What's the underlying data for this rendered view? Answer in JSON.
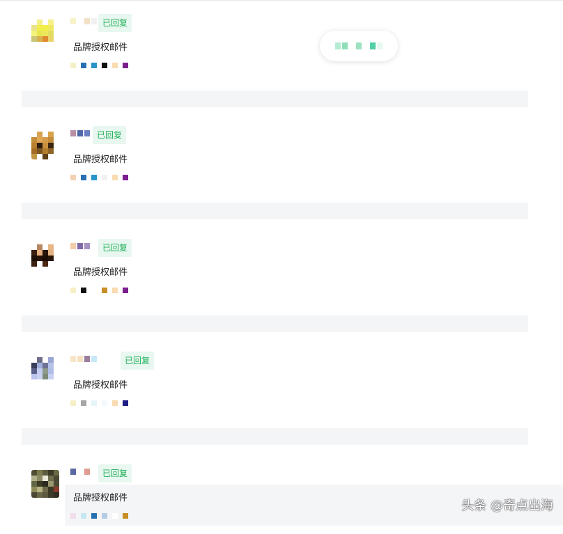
{
  "ui": {
    "replied_badge": "已回复",
    "subject": "品牌授权邮件",
    "watermark": "头条 @奇点出海",
    "colors": {
      "badge_bg": "#e8f7ef",
      "badge_text": "#20b15a",
      "separator": "#f4f5f7"
    }
  },
  "messages": [
    {
      "subject": "品牌授权邮件",
      "status": "已回复",
      "avatar_colors": [
        "#ffffff",
        "#f5ef8a",
        "#ffffff",
        "#f7f08a",
        "#ffffff",
        "#e9e38b",
        "#f2ef4b",
        "#f2ef4b",
        "#efe962",
        "#ffffff",
        "#f3f279",
        "#e8e650",
        "#ece65c",
        "#e3dc62",
        "#ffffff",
        "#c9c67a",
        "#d8b24e",
        "#e08a2e",
        "#e9d36b",
        "#ffffff",
        "#ffffff",
        "#ffffff",
        "#ffffff",
        "#ffffff",
        "#ffffff"
      ],
      "name_colors": [
        "#f7f3c8",
        "#ffffff",
        "#f2e1c5",
        "#f1f1f1"
      ],
      "detail_colors": [
        "#f6f0c7",
        "#2770b1",
        "#2995c9",
        "#111111",
        "#f8dbb0",
        "#7a1f8d"
      ]
    },
    {
      "subject": "品牌授权邮件",
      "status": "已回复",
      "avatar_colors": [
        "#ffffff",
        "#d9a354",
        "#ffffff",
        "#d7a24d",
        "#ffffff",
        "#c38d3b",
        "#e0a95a",
        "#d59b4b",
        "#c48b3a",
        "#ffffff",
        "#b77f2f",
        "#2c1d0f",
        "#c9913f",
        "#3a2612",
        "#ffffff",
        "#a36d23",
        "#7d5521",
        "#b27d2f",
        "#8f6527",
        "#ffffff",
        "#c29744",
        "#ffffff",
        "#5b4019",
        "#ffffff",
        "#ffffff"
      ],
      "name_colors": [
        "#b88fa9",
        "#5168a8",
        "#6b7fc3"
      ],
      "detail_colors": [
        "#f3d1b3",
        "#2770b1",
        "#2995c9",
        "#f1f1f1",
        "#f8dbb0",
        "#7a1f8d"
      ]
    },
    {
      "subject": "品牌授权邮件",
      "status": "已回复",
      "avatar_colors": [
        "#ffffff",
        "#b88760",
        "#ffffff",
        "#e8b684",
        "#ffffff",
        "#3a1e10",
        "#e5b07e",
        "#2a150a",
        "#e3b281",
        "#ffffff",
        "#1c0d05",
        "#281208",
        "#1a0b04",
        "#291409",
        "#ffffff",
        "#3c2011",
        "#ffffff",
        "#4a2814",
        "#ffffff",
        "#ffffff",
        "#ffffff",
        "#ffffff",
        "#ffffff",
        "#ffffff",
        "#ffffff"
      ],
      "name_colors": [
        "#f2cda9",
        "#7e6aa8",
        "#a591c2"
      ],
      "detail_colors": [
        "#f6f0c7",
        "#111111",
        "#ffffff",
        "#c88f25",
        "#f8dbb0",
        "#7a1f8d"
      ]
    },
    {
      "subject": "品牌授权邮件",
      "status": "已回复",
      "avatar_colors": [
        "#ffffff",
        "#6d6f88",
        "#ffffff",
        "#9aa7d4",
        "#ffffff",
        "#3a3e5a",
        "#a0aedd",
        "#6e7396",
        "#b6c2e8",
        "#ffffff",
        "#5b6089",
        "#c2cdef",
        "#8e9a8b",
        "#b0bde5",
        "#ffffff",
        "#b8c4ea",
        "#c9d2f1",
        "#7c8a78",
        "#c7d0f0",
        "#ffffff",
        "#ffffff",
        "#ffffff",
        "#ffffff",
        "#ffffff",
        "#ffffff"
      ],
      "name_colors": [
        "#f7e6c9",
        "#f7e0c1",
        "#9a7e9f",
        "#c7e8f7"
      ],
      "detail_colors": [
        "#f6f0c7",
        "#a4a7a4",
        "#e6f5f8",
        "#f3f8fb",
        "#f8dbb0",
        "#1e1d85"
      ]
    },
    {
      "subject": "品牌授权邮件",
      "status": "已回复",
      "avatar_colors": [
        "#4e4d35",
        "#7d7b4f",
        "#5e5c40",
        "#3b3a27",
        "#6b6a47",
        "#b2b08a",
        "#8a8963",
        "#e9e7d8",
        "#706e4e",
        "#4a4931",
        "#5f6744",
        "#3d3b26",
        "#2c2a1c",
        "#9a986f",
        "#4c4a33",
        "#8f8b5a",
        "#b9b484",
        "#6c6a4a",
        "#3a3925",
        "#8b3b2c",
        "#4a4833",
        "#6a6848",
        "#5b5a3e",
        "#3c3b28",
        "#2f2e20"
      ],
      "name_colors": [
        "#5a6aa1",
        "#ffffff",
        "#e09b92"
      ],
      "detail_colors": [
        "#f1dce9",
        "#c6e6f2",
        "#2770b1",
        "#b4cbe6",
        "#ffffff",
        "#c88f25"
      ]
    }
  ]
}
